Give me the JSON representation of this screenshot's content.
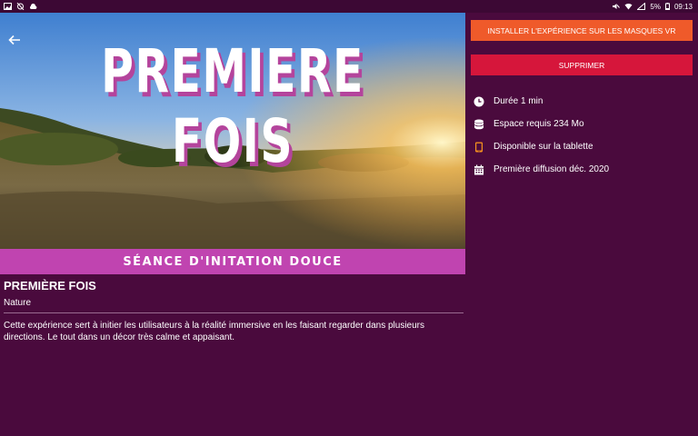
{
  "status_bar": {
    "battery": "5%",
    "time": "09:13"
  },
  "hero": {
    "title": "PREMIERE FOIS"
  },
  "subtitle": "SÉANCE D'INITATION DOUCE",
  "experience": {
    "title": "PREMIÈRE FOIS",
    "category": "Nature",
    "description": "Cette expérience sert à initier les utilisateurs à la réalité immersive en les faisant regarder dans plusieurs directions. Le tout dans un décor très calme et appaisant."
  },
  "actions": {
    "install_label": "INSTALLER L'EXPÉRIENCE SUR LES MASQUES VR",
    "delete_label": "SUPPRIMER"
  },
  "info": [
    {
      "icon": "clock-icon",
      "text": "Durée 1 min"
    },
    {
      "icon": "database-icon",
      "text": "Espace requis 234 Mo"
    },
    {
      "icon": "tablet-icon",
      "text": "Disponible sur la tablette"
    },
    {
      "icon": "calendar-icon",
      "text": "Première diffusion déc. 2020"
    }
  ],
  "colors": {
    "background": "#4a0a3d",
    "accent_pink": "#c044b0",
    "install_orange": "#ef5a2a",
    "delete_red": "#d6163b",
    "tablet_icon": "#f7931e"
  }
}
